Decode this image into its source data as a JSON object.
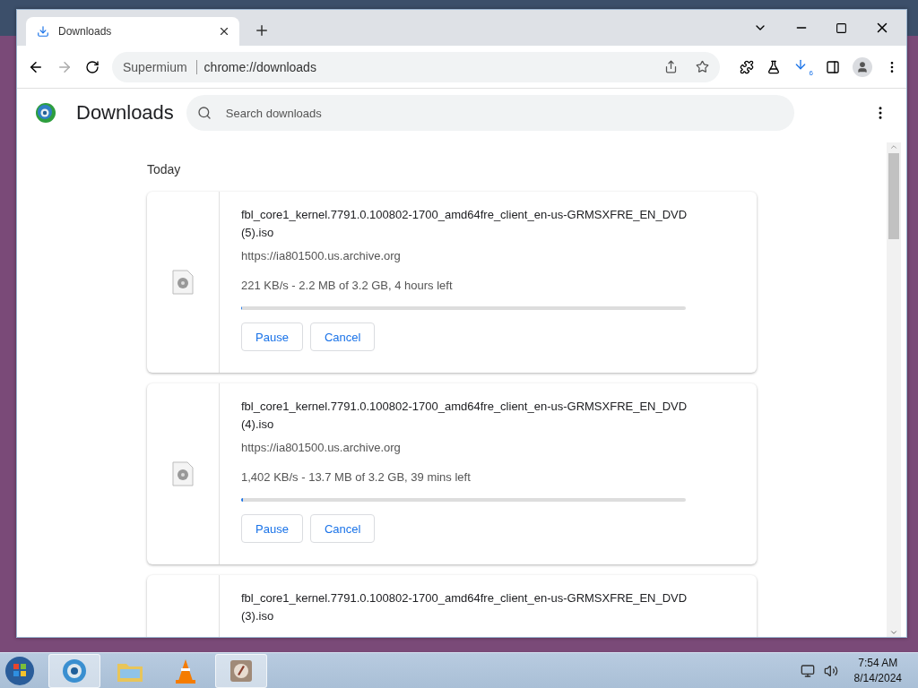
{
  "tabs": [
    {
      "label": "Downloads",
      "selected": true
    }
  ],
  "address": {
    "site_label": "Supermium",
    "url": "chrome://downloads"
  },
  "toolbar": {
    "download_badge": "6"
  },
  "page": {
    "title": "Downloads",
    "search": {
      "placeholder": "Search downloads"
    },
    "section": "Today",
    "downloads": [
      {
        "name": "fbl_core1_kernel.7791.0.100802-1700_amd64fre_client_en-us-GRMSXFRE_EN_DVD (5).iso",
        "url": "https://ia801500.us.archive.org",
        "status": "221 KB/s - 2.2 MB of 3.2 GB, 4 hours left",
        "level": 0.001,
        "buttons": [
          "Pause",
          "Cancel"
        ]
      },
      {
        "name": "fbl_core1_kernel.7791.0.100802-1700_amd64fre_client_en-us-GRMSXFRE_EN_DVD (4).iso",
        "url": "https://ia801500.us.archive.org",
        "status": "1,402 KB/s - 13.7 MB of 3.2 GB, 39 mins left",
        "level": 0.004,
        "buttons": [
          "Pause",
          "Cancel"
        ]
      },
      {
        "name": "fbl_core1_kernel.7791.0.100802-1700_amd64fre_client_en-us-GRMSXFRE_EN_DVD (3).iso"
      }
    ]
  },
  "taskbar": {
    "apps": [
      {
        "kind": "browser",
        "active": true
      },
      {
        "kind": "folder",
        "active": false
      },
      {
        "kind": "cone",
        "active": false
      },
      {
        "kind": "app",
        "active": true
      }
    ],
    "time": "7:54 AM",
    "date": "8/14/2024"
  }
}
